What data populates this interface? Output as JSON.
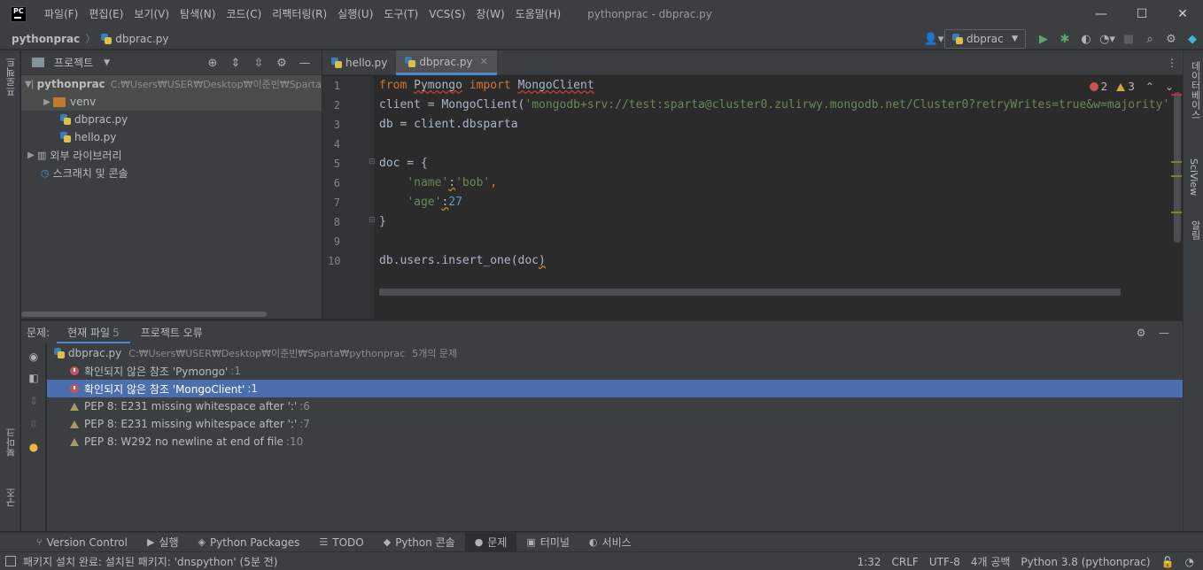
{
  "titlebar": {
    "menu": [
      "파일(F)",
      "편집(E)",
      "보기(V)",
      "탐색(N)",
      "코드(C)",
      "리팩터링(R)",
      "실행(U)",
      "도구(T)",
      "VCS(S)",
      "창(W)",
      "도움말(H)"
    ],
    "window_title": "pythonprac - dbprac.py"
  },
  "navbar": {
    "project": "pythonprac",
    "file": "dbprac.py",
    "run_config": "dbprac"
  },
  "left_stripe": {
    "project_tab": "프로젝트",
    "bookmarks_tab": "북마크",
    "structure_tab": "구조"
  },
  "right_stripe": {
    "database_tab": "데이터베이스",
    "sciview_tab": "SciView",
    "notifications_tab": "알림"
  },
  "project_panel": {
    "title": "프로젝트",
    "root_name": "pythonprac",
    "root_path": "C:₩Users₩USER₩Desktop₩이준빈₩Sparta",
    "items": [
      {
        "label": "venv"
      },
      {
        "label": "dbprac.py"
      },
      {
        "label": "hello.py"
      },
      {
        "label": "외부 라이브러리"
      },
      {
        "label": "스크래치 및 콘솔"
      }
    ]
  },
  "editor": {
    "tabs": [
      {
        "label": "hello.py"
      },
      {
        "label": "dbprac.py"
      }
    ],
    "error_count": "2",
    "warning_count": "3",
    "line_numbers": [
      "1",
      "2",
      "3",
      "4",
      "5",
      "6",
      "7",
      "8",
      "9",
      "10"
    ],
    "code": {
      "l1_from": "from",
      "l1_module": "Pymongo",
      "l1_import": "import",
      "l1_name": "MongoClient",
      "l2_pre": "client = MongoClient(",
      "l2_str": "'mongodb+srv://test:sparta@cluster0.zulirwy.mongodb.net/Cluster0?retryWrites=true&w=majority'",
      "l3": "db = client.dbsparta",
      "l5": "doc = {",
      "l6_key": "'name'",
      "l6_colon": ":",
      "l6_val": "'bob'",
      "l6_comma": ",",
      "l7_key": "'age'",
      "l7_colon": ":",
      "l7_val": "27",
      "l8": "}",
      "l10_pre": "db.users.insert_one(doc",
      "l10_end": ")"
    }
  },
  "problems": {
    "label": "문제:",
    "tabs": [
      {
        "label": "현재 파일",
        "count": "5"
      },
      {
        "label": "프로젝트 오류",
        "count": ""
      }
    ],
    "file_row": {
      "file": "dbprac.py",
      "path": "C:₩Users₩USER₩Desktop₩이준빈₩Sparta₩pythonprac",
      "summary": "5개의 문제"
    },
    "items": [
      {
        "kind": "error",
        "text": "확인되지 않은 참조 'Pymongo'",
        "loc": ":1"
      },
      {
        "kind": "error",
        "text": "확인되지 않은 참조 'MongoClient'",
        "loc": ":1"
      },
      {
        "kind": "warning",
        "text": "PEP 8: E231 missing whitespace after ':'",
        "loc": ":6"
      },
      {
        "kind": "warning",
        "text": "PEP 8: E231 missing whitespace after ':'",
        "loc": ":7"
      },
      {
        "kind": "warning",
        "text": "PEP 8: W292 no newline at end of file",
        "loc": ":10"
      }
    ]
  },
  "bottom_tools": [
    {
      "label": "Version Control"
    },
    {
      "label": "실행"
    },
    {
      "label": "Python Packages"
    },
    {
      "label": "TODO"
    },
    {
      "label": "Python 콘솔"
    },
    {
      "label": "문제"
    },
    {
      "label": "터미널"
    },
    {
      "label": "서비스"
    }
  ],
  "statusbar": {
    "message": "패키지 설치 완료: 설치된 패키지: 'dnspython' (5분 전)",
    "position": "1:32",
    "line_sep": "CRLF",
    "encoding": "UTF-8",
    "indent": "4개 공백",
    "interpreter": "Python 3.8 (pythonprac)"
  },
  "colors": {
    "accent": "#4a88c7",
    "selection": "#4b6eaf",
    "error": "#c75450",
    "warning": "#d9a343"
  }
}
